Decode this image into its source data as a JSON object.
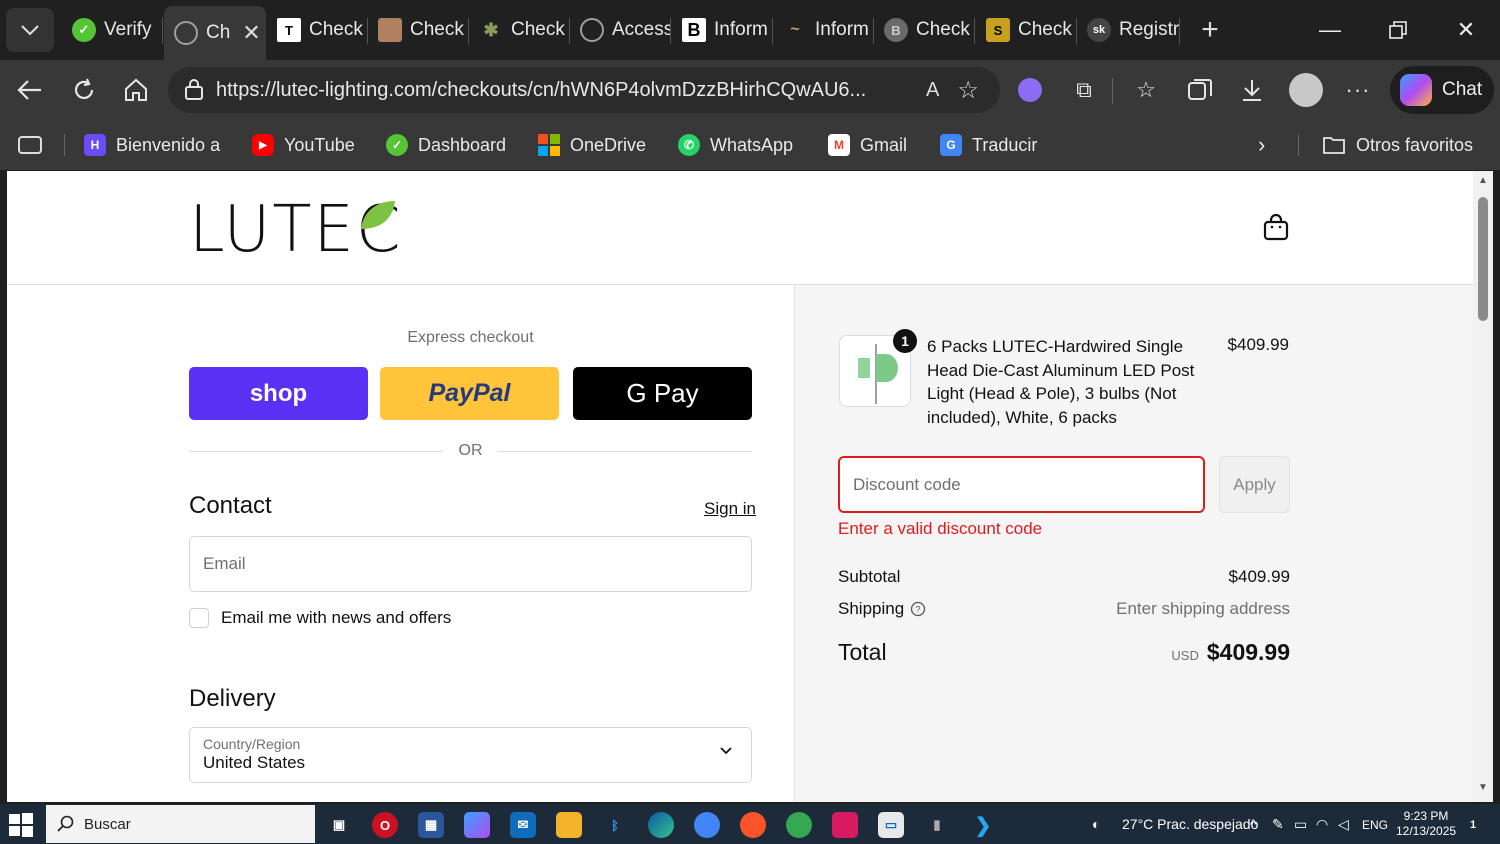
{
  "browser": {
    "tabs": [
      {
        "label": "Verify",
        "icon": "green-check-icon",
        "color": "#55c535"
      },
      {
        "label": "Ch",
        "icon": "globe-icon",
        "color": "#9aa0a6",
        "active": true
      },
      {
        "label": "Check",
        "icon": "letter-t-icon",
        "color": "#ffffff"
      },
      {
        "label": "Check",
        "icon": "photo-icon",
        "color": "#b08060"
      },
      {
        "label": "Check",
        "icon": "leaf-icon",
        "color": "#5a6a3a"
      },
      {
        "label": "Access",
        "icon": "globe-icon",
        "color": "#9aa0a6"
      },
      {
        "label": "Inform",
        "icon": "letter-b-icon",
        "color": "#ffffff"
      },
      {
        "label": "Inform",
        "icon": "bird-icon",
        "color": "#c0a070"
      },
      {
        "label": "Check",
        "icon": "letter-b-circle-icon",
        "color": "#777777"
      },
      {
        "label": "Check",
        "icon": "brand-s-icon",
        "color": "#c8a020"
      },
      {
        "label": "Registr",
        "icon": "sk-icon",
        "color": "#444444"
      }
    ],
    "url": "https://lutec-lighting.com/checkouts/cn/hWN6P4olvmDzzBHirhCQwAU6...",
    "chat_label": "Chat",
    "bookmarks": [
      {
        "label": "Bienvenido a",
        "icon": "purple-logo-icon",
        "color": "#6b4cf6"
      },
      {
        "label": "YouTube",
        "icon": "youtube-icon",
        "color": "#ff0000"
      },
      {
        "label": "Dashboard",
        "icon": "green-check-icon",
        "color": "#55c535"
      },
      {
        "label": "OneDrive",
        "icon": "microsoft-icon",
        "color": "#f25022"
      },
      {
        "label": "WhatsApp",
        "icon": "whatsapp-icon",
        "color": "#25d366"
      },
      {
        "label": "Gmail",
        "icon": "gmail-icon",
        "color": "#ea4335"
      },
      {
        "label": "Traducir",
        "icon": "translate-icon",
        "color": "#4285f4"
      }
    ],
    "other_favorites": "Otros favoritos"
  },
  "checkout": {
    "brand": "LUTEC",
    "express_title": "Express checkout",
    "shop_label": "shop",
    "paypal_label": "PayPal",
    "gpay_label": "G Pay",
    "or_label": "OR",
    "contact_heading": "Contact",
    "sign_in": "Sign in",
    "email_placeholder": "Email",
    "newsletter_label": "Email me with news and offers",
    "delivery_heading": "Delivery",
    "country_label": "Country/Region",
    "country_value": "United States"
  },
  "summary": {
    "quantity": "1",
    "product_name": "6 Packs LUTEC-Hardwired Single Head Die-Cast Aluminum LED Post Light (Head & Pole), 3 bulbs (Not included), White, 6 packs",
    "product_price": "$409.99",
    "discount_placeholder": "Discount code",
    "apply_label": "Apply",
    "discount_error": "Enter a valid discount code",
    "subtotal_label": "Subtotal",
    "subtotal_value": "$409.99",
    "shipping_label": "Shipping",
    "shipping_value": "Enter shipping address",
    "total_label": "Total",
    "currency": "USD",
    "total_value": "$409.99"
  },
  "taskbar": {
    "search_placeholder": "Buscar",
    "weather": "27°C  Prac. despejado",
    "language": "ENG",
    "time": "9:23 PM",
    "date": "12/13/2025",
    "notifications": "1"
  }
}
